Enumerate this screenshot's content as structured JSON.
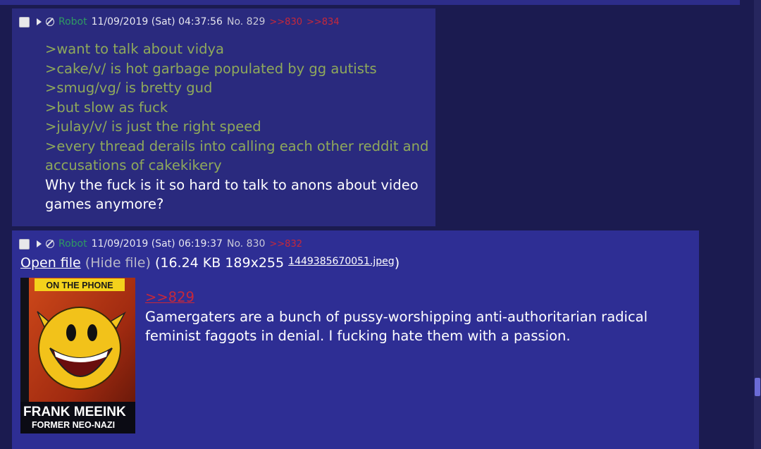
{
  "post1": {
    "name": "Robot",
    "datetime": "11/09/2019 (Sat) 04:37:56",
    "number": "No. 829",
    "backlinks": [
      ">>830",
      ">>834"
    ],
    "lines": [
      ">want to talk about vidya",
      ">cake/v/ is hot garbage populated by gg autists",
      ">smug/vg/ is bretty gud",
      ">but slow as fuck",
      ">julay/v/ is just the right speed",
      ">every thread derails into calling each other reddit and",
      "accusations of cakekikery",
      "Why the fuck is it so hard to talk to anons about video",
      "games anymore?"
    ]
  },
  "post2": {
    "name": "Robot",
    "datetime": "11/09/2019 (Sat) 06:19:37",
    "number": "No. 830",
    "backlinks": [
      ">>832"
    ],
    "open_file": "Open file",
    "hide_file": "(Hide file)",
    "file_info": "(16.24 KB 189x255",
    "file_name": "1449385670051.jpeg",
    "file_close": ")",
    "image": {
      "top_text": "ON THE PHONE",
      "caption_name": "FRANK MEEINK",
      "caption_title": "FORMER NEO-NAZI"
    },
    "quote": ">>829",
    "lines": [
      "Gamergaters are a bunch of pussy-worshipping anti-authoritarian radical",
      "feminist faggots in denial. I fucking hate them with a passion."
    ]
  },
  "colors": {
    "background": "#1b1b50",
    "post_bg": "#2e2e94",
    "greentext": "#8fa95b",
    "name": "#2f9a62",
    "backlink": "#c7283a"
  }
}
